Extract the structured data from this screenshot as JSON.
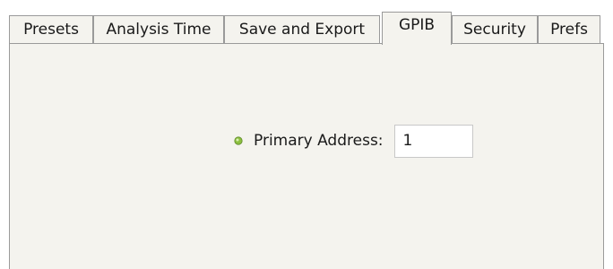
{
  "tabs": [
    {
      "label": "Presets",
      "active": false
    },
    {
      "label": "Analysis Time",
      "active": false
    },
    {
      "label": "Save and Export",
      "active": false
    },
    {
      "label": "GPIB",
      "active": true
    },
    {
      "label": "Security",
      "active": false
    },
    {
      "label": "Prefs",
      "active": false
    }
  ],
  "gpib": {
    "primary_address_label": "Primary Address:",
    "primary_address_value": "1",
    "bullet_icon": "radio-dot-icon",
    "bullet_color": "#8cbf3f"
  },
  "colors": {
    "panel_background": "#f4f3ee",
    "border": "#9a9a9a"
  }
}
